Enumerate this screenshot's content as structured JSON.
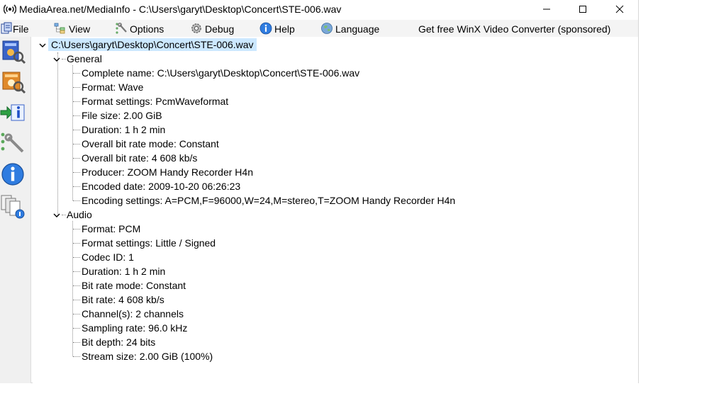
{
  "window": {
    "title": "MediaArea.net/MediaInfo - C:\\Users\\garyt\\Desktop\\Concert\\STE-006.wav"
  },
  "menu": {
    "file": "File",
    "view": "View",
    "options": "Options",
    "debug": "Debug",
    "help": "Help",
    "language": "Language",
    "sponsor": "Get free WinX Video Converter (sponsored)"
  },
  "sidebar": {
    "icons": [
      "basic-view-icon",
      "sheet-view-icon",
      "export-icon",
      "preferences-icon",
      "about-icon",
      "reports-icon"
    ]
  },
  "tree": {
    "root": "C:\\Users\\garyt\\Desktop\\Concert\\STE-006.wav",
    "general": {
      "label": "General",
      "items": [
        "Complete name: C:\\Users\\garyt\\Desktop\\Concert\\STE-006.wav",
        "Format: Wave",
        "Format settings: PcmWaveformat",
        "File size: 2.00 GiB",
        "Duration: 1 h 2 min",
        "Overall bit rate mode: Constant",
        "Overall bit rate: 4 608 kb/s",
        "Producer: ZOOM Handy Recorder H4n",
        "Encoded date: 2009-10-20 06:26:23",
        "Encoding settings: A=PCM,F=96000,W=24,M=stereo,T=ZOOM Handy Recorder H4n"
      ]
    },
    "audio": {
      "label": "Audio",
      "items": [
        "Format: PCM",
        "Format settings: Little / Signed",
        "Codec ID: 1",
        "Duration: 1 h 2 min",
        "Bit rate mode: Constant",
        "Bit rate: 4 608 kb/s",
        "Channel(s): 2 channels",
        "Sampling rate: 96.0 kHz",
        "Bit depth: 24 bits",
        "Stream size: 2.00 GiB (100%)"
      ]
    }
  }
}
